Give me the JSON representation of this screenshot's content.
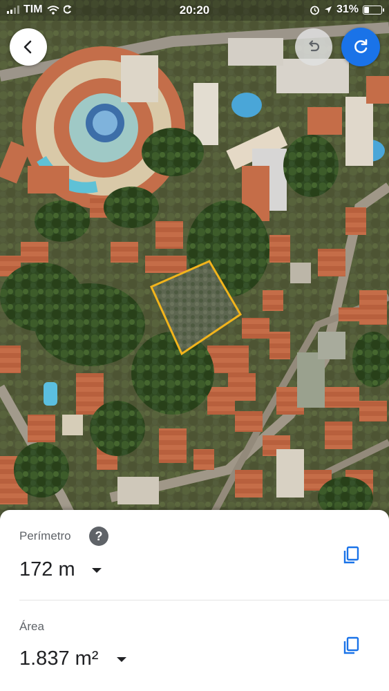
{
  "status_bar": {
    "carrier": "TIM",
    "time": "20:20",
    "battery": "31%",
    "battery_level": 0.31
  },
  "map": {
    "type": "satellite",
    "measurement_outline_color": "#f2b41c"
  },
  "controls": {
    "back_icon": "chevron-left-icon",
    "undo_icon": "undo-icon",
    "redo_icon": "redo-icon",
    "accent": "#1a73e8"
  },
  "results": {
    "perimeter": {
      "label": "Perímetro",
      "value": "172 m",
      "help_icon": "?"
    },
    "area": {
      "label": "Área",
      "value": "1.837 m²"
    }
  }
}
